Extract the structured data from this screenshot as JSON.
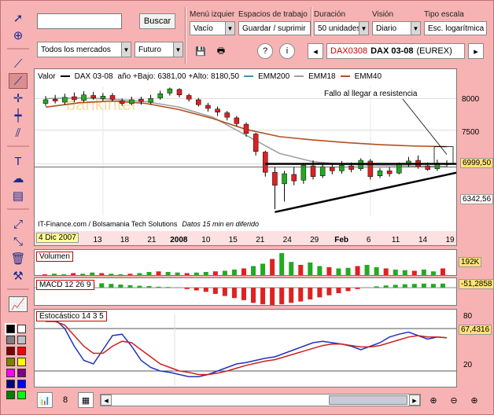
{
  "toolbar_top": {
    "search_placeholder": "",
    "search_button": "Buscar",
    "market_select": "Todos los mercados",
    "type_select": "Futuro",
    "menu_label": "Menú izquier",
    "menu_value": "Vacío",
    "workspace_label": "Espacios de trabajo",
    "workspace_value": "Guardar / suprimir",
    "duration_label": "Duración",
    "duration_value": "50 unidades",
    "view_label": "Visión",
    "view_value": "Diario",
    "scale_label": "Tipo escala",
    "scale_value": "Esc. logarítmica",
    "instrument_code": "DAX0308",
    "instrument_name": "DAX 03-08",
    "instrument_exchange": "(EUREX)"
  },
  "main_chart": {
    "header_label": "Valor",
    "series_name": "DAX 03-08",
    "stats_text": "año +Bajo: 6381,00 +Alto: 8180,50",
    "legend": [
      {
        "name": "EMM200",
        "color": "#3a9aa8"
      },
      {
        "name": "EMM18",
        "color": "#a0a0a0"
      },
      {
        "name": "EMM40",
        "color": "#b05020"
      }
    ],
    "annotation": "Fallo al llegar a resistencia",
    "watermark": "bankinter",
    "source_text": "IT-Finance.com / Bolsamania Tech Solutions",
    "source_note": "Datos 15 min en diferido",
    "y_ticks": [
      "8000",
      "7500",
      "7000"
    ],
    "last_price": "6999,50",
    "low_price": "6342,56",
    "date_start": "4 Dic 2007",
    "x_labels": [
      "13",
      "18",
      "21",
      "2008",
      "10",
      "15",
      "21",
      "24",
      "29",
      "Feb",
      "6",
      "11",
      "14",
      "19"
    ]
  },
  "chart_data": [
    {
      "type": "candlestick",
      "title": "DAX 03-08",
      "ylim": [
        6300,
        8200
      ],
      "y_scale": "log",
      "candles": [
        {
          "o": 7920,
          "c": 7980,
          "h": 8040,
          "l": 7880
        },
        {
          "o": 7990,
          "c": 7960,
          "h": 8060,
          "l": 7920
        },
        {
          "o": 7940,
          "c": 8020,
          "h": 8080,
          "l": 7900
        },
        {
          "o": 8030,
          "c": 7980,
          "h": 8100,
          "l": 7940
        },
        {
          "o": 7970,
          "c": 8060,
          "h": 8120,
          "l": 7940
        },
        {
          "o": 8050,
          "c": 8010,
          "h": 8110,
          "l": 7980
        },
        {
          "o": 8000,
          "c": 8040,
          "h": 8090,
          "l": 7960
        },
        {
          "o": 8050,
          "c": 7990,
          "h": 8090,
          "l": 7950
        },
        {
          "o": 7960,
          "c": 7920,
          "h": 8000,
          "l": 7880
        },
        {
          "o": 7920,
          "c": 7980,
          "h": 8030,
          "l": 7890
        },
        {
          "o": 7990,
          "c": 7950,
          "h": 8030,
          "l": 7900
        },
        {
          "o": 7940,
          "c": 8000,
          "h": 8060,
          "l": 7900
        },
        {
          "o": 8010,
          "c": 8080,
          "h": 8130,
          "l": 7980
        },
        {
          "o": 8090,
          "c": 8160,
          "h": 8180,
          "l": 8050
        },
        {
          "o": 8150,
          "c": 8060,
          "h": 8170,
          "l": 8020
        },
        {
          "o": 8050,
          "c": 7990,
          "h": 8080,
          "l": 7950
        },
        {
          "o": 7980,
          "c": 7900,
          "h": 8010,
          "l": 7870
        },
        {
          "o": 7890,
          "c": 7840,
          "h": 7930,
          "l": 7790
        },
        {
          "o": 7830,
          "c": 7780,
          "h": 7870,
          "l": 7720
        },
        {
          "o": 7770,
          "c": 7700,
          "h": 7800,
          "l": 7650
        },
        {
          "o": 7690,
          "c": 7600,
          "h": 7720,
          "l": 7560
        },
        {
          "o": 7590,
          "c": 7450,
          "h": 7620,
          "l": 7400
        },
        {
          "o": 7440,
          "c": 7180,
          "h": 7460,
          "l": 7120
        },
        {
          "o": 7170,
          "c": 6880,
          "h": 7190,
          "l": 6820
        },
        {
          "o": 6880,
          "c": 6700,
          "h": 6950,
          "l": 6380
        },
        {
          "o": 6720,
          "c": 6860,
          "h": 6900,
          "l": 6480
        },
        {
          "o": 6850,
          "c": 6760,
          "h": 6960,
          "l": 6700
        },
        {
          "o": 6770,
          "c": 6980,
          "h": 7010,
          "l": 6720
        },
        {
          "o": 6970,
          "c": 6820,
          "h": 7050,
          "l": 6780
        },
        {
          "o": 6830,
          "c": 6960,
          "h": 7010,
          "l": 6800
        },
        {
          "o": 6950,
          "c": 6900,
          "h": 7010,
          "l": 6850
        },
        {
          "o": 6900,
          "c": 6980,
          "h": 7040,
          "l": 6860
        },
        {
          "o": 6970,
          "c": 6920,
          "h": 7020,
          "l": 6880
        },
        {
          "o": 6930,
          "c": 7050,
          "h": 7080,
          "l": 6900
        },
        {
          "o": 7040,
          "c": 6820,
          "h": 7070,
          "l": 6780
        },
        {
          "o": 6830,
          "c": 6900,
          "h": 6940,
          "l": 6800
        },
        {
          "o": 6900,
          "c": 6860,
          "h": 6950,
          "l": 6820
        },
        {
          "o": 6870,
          "c": 6990,
          "h": 7020,
          "l": 6850
        },
        {
          "o": 6990,
          "c": 7040,
          "h": 7100,
          "l": 6950
        },
        {
          "o": 7050,
          "c": 6960,
          "h": 7120,
          "l": 6930
        },
        {
          "o": 6970,
          "c": 6920,
          "h": 7020,
          "l": 6900
        },
        {
          "o": 6930,
          "c": 7010,
          "h": 7060,
          "l": 6900
        },
        {
          "o": 7000,
          "c": 6990,
          "h": 7050,
          "l": 6950
        }
      ],
      "ema200": [
        7620,
        7860
      ],
      "ema18": [
        8000,
        8010,
        7990,
        7950,
        7860,
        7700,
        7420,
        7150,
        7030,
        6990,
        6980,
        6970,
        6960
      ],
      "ema40": [
        7860,
        7930,
        7960,
        7920,
        7820,
        7680,
        7510,
        7400,
        7350,
        7310,
        7280,
        7260,
        7250
      ],
      "resistance": 7000,
      "support": [
        6342.56,
        6990
      ]
    },
    {
      "type": "bar",
      "title": "Volumen",
      "last_value": "192K",
      "values": [
        4,
        5,
        4,
        6,
        5,
        7,
        6,
        5,
        4,
        5,
        6,
        8,
        9,
        8,
        7,
        6,
        7,
        8,
        9,
        10,
        12,
        14,
        18,
        22,
        30,
        40,
        25,
        20,
        24,
        18,
        16,
        14,
        15,
        18,
        20,
        16,
        14,
        12,
        11,
        10,
        12,
        9,
        14
      ]
    },
    {
      "type": "histogram",
      "title": "MACD 12 26 9",
      "last_value": "-51,2858",
      "values": [
        10,
        12,
        14,
        16,
        18,
        16,
        14,
        12,
        10,
        8,
        6,
        5,
        3,
        2,
        1,
        -2,
        -4,
        -6,
        -9,
        -12,
        -15,
        -18,
        -22,
        -24,
        -25,
        -24,
        -22,
        -20,
        -17,
        -14,
        -11,
        -8,
        -5,
        -2,
        1,
        4,
        7,
        9,
        11,
        12,
        13,
        12,
        13
      ]
    },
    {
      "type": "line",
      "title": "Estocástico 14 3 5",
      "last_value": "67,4316",
      "y_ticks": [
        "80",
        "20"
      ],
      "series": [
        {
          "color": "#2233bb",
          "values": [
            95,
            93,
            80,
            55,
            35,
            30,
            50,
            70,
            72,
            55,
            35,
            25,
            20,
            18,
            15,
            12,
            12,
            15,
            20,
            25,
            30,
            32,
            35,
            38,
            40,
            45,
            50,
            55,
            60,
            62,
            60,
            58,
            55,
            50,
            55,
            60,
            68,
            72,
            75,
            70,
            65,
            68,
            67
          ]
        },
        {
          "color": "#cc2222",
          "values": [
            90,
            90,
            85,
            70,
            55,
            45,
            45,
            55,
            62,
            60,
            50,
            40,
            30,
            25,
            20,
            18,
            15,
            15,
            17,
            20,
            24,
            28,
            31,
            34,
            36,
            40,
            44,
            48,
            52,
            56,
            58,
            58,
            56,
            54,
            54,
            56,
            60,
            64,
            68,
            70,
            68,
            68,
            67
          ]
        }
      ]
    }
  ],
  "panels": {
    "volume_label": "Volumen",
    "volume_last": "192K",
    "macd_label": "MACD 12 26 9",
    "macd_last": "-51,2858",
    "stoch_label": "Estocástico 14 3 5",
    "stoch_last": "67,4316",
    "stoch_upper": "80",
    "stoch_lower": "20"
  }
}
